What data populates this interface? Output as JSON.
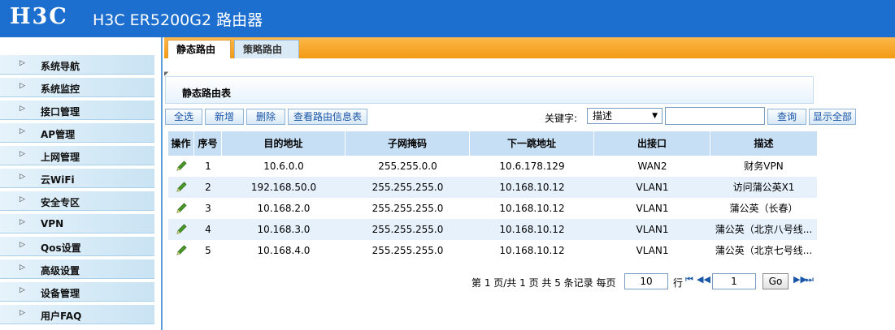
{
  "header": {
    "logo": "H3C",
    "title": "H3C ER5200G2 路由器"
  },
  "sidebar": {
    "items": [
      {
        "label": "系统导航"
      },
      {
        "label": "系统监控"
      },
      {
        "label": "接口管理"
      },
      {
        "label": "AP管理"
      },
      {
        "label": "上网管理"
      },
      {
        "label": "云WiFi"
      },
      {
        "label": "安全专区"
      },
      {
        "label": "VPN"
      },
      {
        "label": "Qos设置"
      },
      {
        "label": "高级设置"
      },
      {
        "label": "设备管理"
      },
      {
        "label": "用户FAQ"
      }
    ],
    "arrow": "▷"
  },
  "tabs": [
    {
      "label": "静态路由"
    },
    {
      "label": "策略路由"
    }
  ],
  "panel": {
    "title": "静态路由表"
  },
  "toolbar": {
    "select_all": "全选",
    "add": "新增",
    "delete": "删除",
    "view_info": "查看路由信息表",
    "keyword_label": "关键字:",
    "keyword_field": "描述",
    "keyword_value": "",
    "search": "查询",
    "show_all": "显示全部"
  },
  "table": {
    "headers": [
      "操作",
      "序号",
      "目的地址",
      "子网掩码",
      "下一跳地址",
      "出接口",
      "描述"
    ],
    "rows": [
      {
        "id": "1",
        "dest": "10.6.0.0",
        "mask": "255.255.0.0",
        "next_hop": "10.6.178.129",
        "iface": "WAN2",
        "desc": "财务VPN"
      },
      {
        "id": "2",
        "dest": "192.168.50.0",
        "mask": "255.255.255.0",
        "next_hop": "10.168.10.12",
        "iface": "VLAN1",
        "desc": "访问蒲公英X1"
      },
      {
        "id": "3",
        "dest": "10.168.2.0",
        "mask": "255.255.255.0",
        "next_hop": "10.168.10.12",
        "iface": "VLAN1",
        "desc": "蒲公英（长春）"
      },
      {
        "id": "4",
        "dest": "10.168.3.0",
        "mask": "255.255.255.0",
        "next_hop": "10.168.10.12",
        "iface": "VLAN1",
        "desc": "蒲公英（北京八号线..."
      },
      {
        "id": "5",
        "dest": "10.168.4.0",
        "mask": "255.255.255.0",
        "next_hop": "10.168.10.12",
        "iface": "VLAN1",
        "desc": "蒲公英（北京七号线..."
      }
    ]
  },
  "pager": {
    "summary": "第 1 页/共 1 页 共 5 条记录 每页",
    "per_page": "10",
    "rows_unit": "行",
    "page": "1",
    "go": "Go",
    "first": "⏮",
    "prev": "◀◀",
    "next": "▶▶",
    "last": "⏭"
  },
  "colors": {
    "header": "#1c6fcf",
    "tabbar": "#f29a14",
    "accent": "#1a56a8"
  }
}
